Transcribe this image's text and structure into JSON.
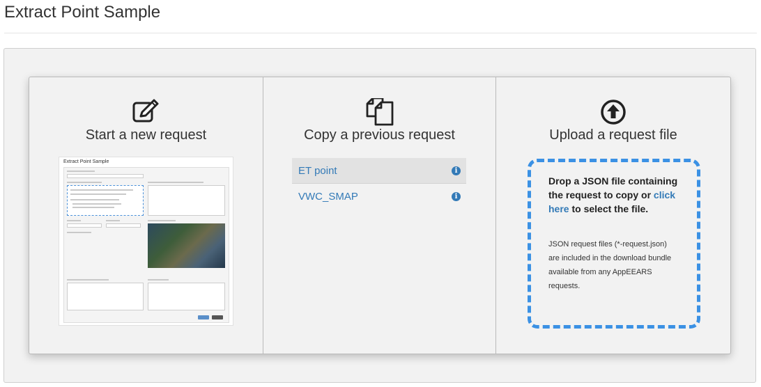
{
  "page": {
    "title": "Extract Point Sample"
  },
  "options": {
    "new_request": {
      "title": "Start a new request",
      "icon": "edit-icon"
    },
    "copy_request": {
      "title": "Copy a previous request",
      "icon": "copy-icon",
      "items": [
        {
          "label": "ET point",
          "selected": true
        },
        {
          "label": "VWC_SMAP",
          "selected": false
        }
      ]
    },
    "upload_request": {
      "title": "Upload a request file",
      "icon": "upload-circle-icon",
      "drop_text_before": "Drop a JSON file containing the request to copy or ",
      "drop_link": "click here",
      "drop_text_after": " to select the file.",
      "note": "JSON request files (*-request.json) are included in the download bundle available from any AppEEARS requests."
    }
  },
  "thumbnail": {
    "title": "Extract Point Sample"
  },
  "colors": {
    "accent": "#337ab7",
    "drop_border": "#3b91e4",
    "panel_bg": "#f2f2f2"
  }
}
